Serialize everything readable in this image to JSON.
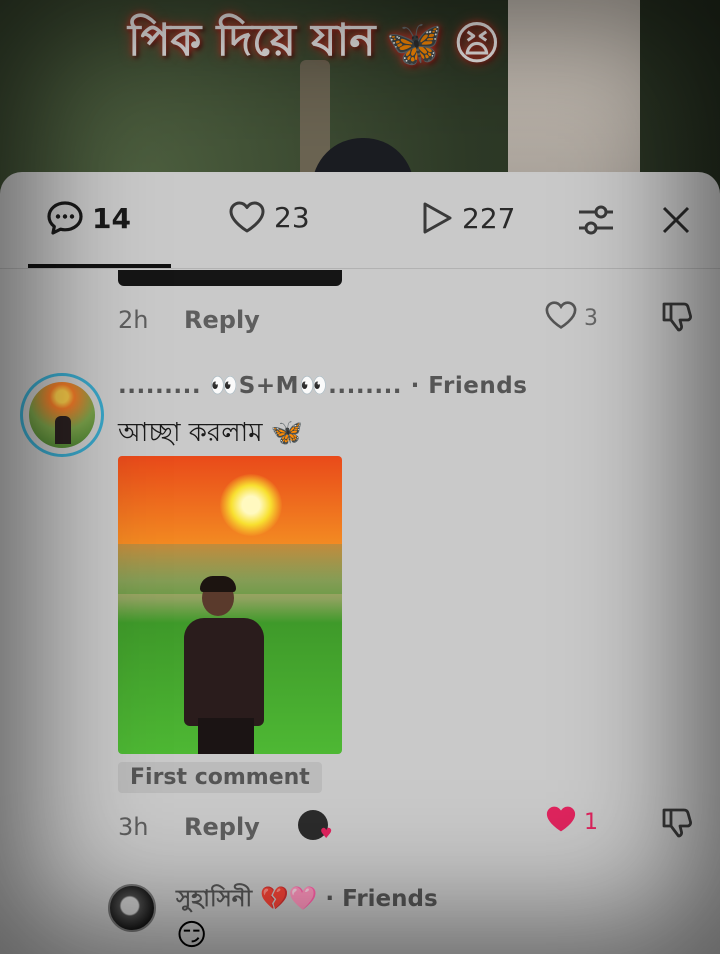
{
  "video": {
    "caption": "পিক দিয়ে যান",
    "caption_emojis": [
      "🦋",
      "😫"
    ]
  },
  "tabs": {
    "comments_count": "14",
    "likes_count": "23",
    "views_count": "227",
    "active": "comments"
  },
  "previous_comment": {
    "time": "2h",
    "reply_label": "Reply",
    "likes": "3"
  },
  "comment": {
    "username": "......... 👀S+M👀........",
    "relation": "· Friends",
    "text": "আচ্ছা করলাম 🦋",
    "badge": "First comment",
    "time": "3h",
    "reply_label": "Reply",
    "likes": "1",
    "liked": true
  },
  "comment2": {
    "username": "সুহাসিনী 💔🩷",
    "relation": "· Friends",
    "text": "😏"
  },
  "colors": {
    "sheet_bg": "#c9c9c9",
    "liked_heart": "#e0245e",
    "avatar_ring": "#3aa7c9"
  }
}
